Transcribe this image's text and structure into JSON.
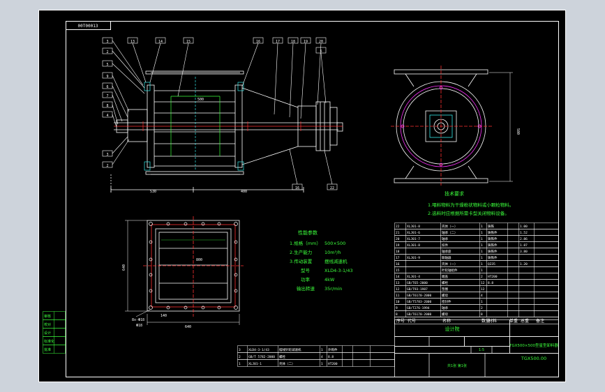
{
  "title_tag": "00T00013",
  "callouts_left": [
    "3",
    "2",
    "5",
    "9",
    "6",
    "7",
    "8",
    "4",
    "3",
    "2"
  ],
  "callouts_top": [
    "13",
    "14",
    "15",
    "16",
    "17",
    "18",
    "19",
    "20",
    "6"
  ],
  "callout_bottom_right": "22",
  "callout_bottom_mid": "16",
  "front_dims": {
    "width_left": "530",
    "width_right": "400",
    "inner_height": "500"
  },
  "side_dims": {
    "height": "580"
  },
  "plan_dims": {
    "width": "800",
    "outer": "840",
    "height": "640",
    "bottom": "640",
    "bolt_label": "8x-Φ18",
    "bolt_sub": "Φ18",
    "small_dim": "140"
  },
  "tech_notes": {
    "title": "技术要求",
    "items": [
      "1.喂料物料为干燥粉状物料或小颗粒物料。",
      "2.选料时应根据所需卡型关闭物料设备。"
    ]
  },
  "performance": {
    "title": "性能参数",
    "rows": [
      {
        "label": "1.规格（mm）",
        "value": "500×500"
      },
      {
        "label": "2.生产能力",
        "value": "10m³/h"
      },
      {
        "label": "3.传动装置",
        "value": "摆线减速机"
      },
      {
        "label": "型号",
        "value": "XLD4-3-1/43"
      },
      {
        "label": "功率",
        "value": "4kW"
      },
      {
        "label": "输出转速",
        "value": "35r/min"
      }
    ]
  },
  "parts_upper": [
    [
      "22",
      "XLJ01-8",
      "壳体（一）",
      "1",
      "铸铁",
      "",
      "1.00"
    ],
    [
      "21",
      "XLJ01-6",
      "轴承（二）",
      "1",
      "铸铁件",
      "",
      "1.52"
    ],
    [
      "20",
      "XLJ01-7",
      "轴承",
      "1",
      "铸铁件",
      "",
      "2.86"
    ],
    [
      "19",
      "XLJ01-8",
      "扣件",
      "1",
      "铸铁件",
      "",
      "1.87"
    ],
    [
      "18",
      "",
      "轴承座",
      "1",
      "铸铁件",
      "",
      "3.80"
    ],
    [
      "17",
      "XLJ01-9",
      "联轴器",
      "1",
      "铸铁件",
      "",
      ""
    ],
    [
      "16",
      "",
      "壳体（一）",
      "1",
      "Q235",
      "",
      "1.20"
    ],
    [
      "15",
      "",
      "叶轮轴组件",
      "1",
      "",
      "",
      ""
    ],
    [
      "14",
      "XLJ01-4",
      "端盖",
      "2",
      "HT200",
      "",
      ""
    ],
    [
      "13",
      "GB/T65-2000",
      "螺栓",
      "12",
      "8.8",
      "",
      ""
    ],
    [
      "12",
      "GB/T93-1987",
      "垫圈",
      "12",
      "",
      "",
      ""
    ],
    [
      "11",
      "GB/T6170-2000",
      "螺母",
      "4",
      "",
      "",
      ""
    ],
    [
      "10",
      "GB/T5783-2000",
      "密封件",
      "1",
      "",
      "",
      ""
    ],
    [
      "9",
      "GB/T276-1994",
      "轴承",
      "2",
      "",
      "",
      ""
    ],
    [
      "8",
      "GB/T6170-2000",
      "螺母",
      "8",
      "",
      "",
      ""
    ]
  ],
  "parts_header": [
    "序号",
    "代号",
    "名称",
    "数量",
    "材料",
    "单重",
    "总重",
    "备注"
  ],
  "parts_lower": [
    [
      "3",
      "XLD4-3-1/43",
      "摆线针轮减速机",
      "1",
      "外购件",
      "",
      ""
    ],
    [
      "2",
      "GB/T 5782-2000",
      "螺栓",
      "4",
      "8.8",
      "",
      ""
    ],
    [
      "1",
      "XLJ01-1",
      "壳体（二）",
      "1",
      "HT200",
      "",
      ""
    ]
  ],
  "title_block": {
    "company": "设计院",
    "drawing_name": "TGX500×500型星型卸料器",
    "drawing_no": "TGX500.00",
    "scale": "1:5",
    "sheet": "共1张 第1张"
  },
  "side_strip": [
    "审核",
    "校对",
    "设计",
    "标准化",
    "批准"
  ],
  "colors": {
    "line": "#ffffff",
    "cyan": "#35e8e8",
    "red": "#ff3030",
    "green": "#3cff3c",
    "magenta": "#ff33ff",
    "yellow": "#ffd400"
  }
}
